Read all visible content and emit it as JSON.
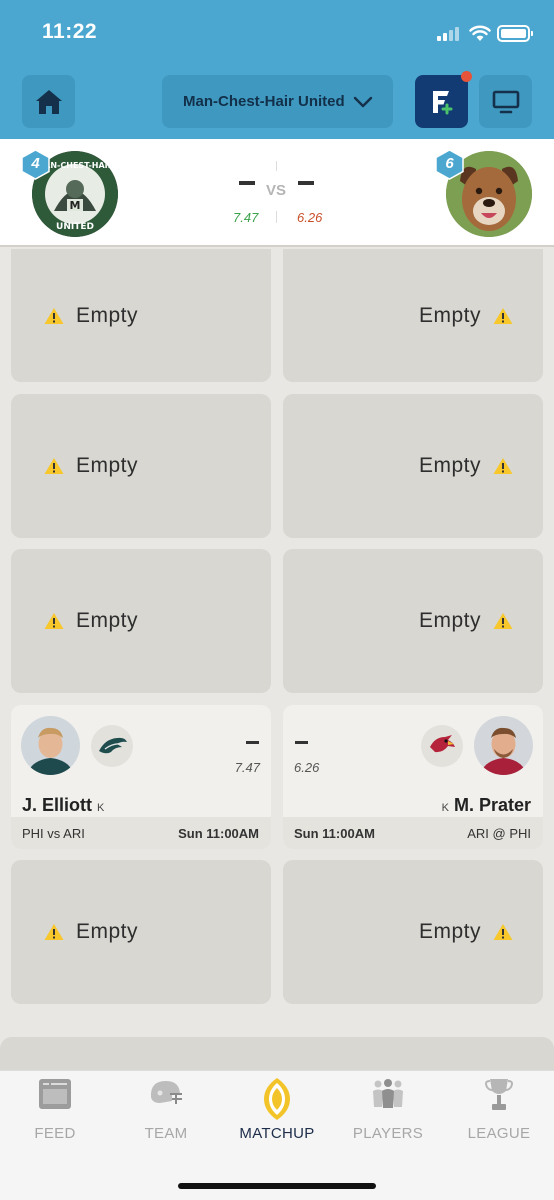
{
  "status_bar": {
    "time": "11:22"
  },
  "header": {
    "team_name": "Man-Chest-Hair United",
    "home_icon": "home-icon",
    "dropdown_icon": "chevron-down-icon",
    "fanduel_icon": "fantasy-logo-icon",
    "tv_icon": "tv-icon"
  },
  "scoreboard": {
    "left_rank": "4",
    "right_rank": "6",
    "left_score": "–",
    "right_score": "–",
    "vs": "VS",
    "left_projection": "7.47",
    "right_projection": "6.26",
    "left_avatar_text_top": "MAN-CHEST-HAIR",
    "left_avatar_text_bottom": "UNITED",
    "left_avatar_letter": "M"
  },
  "slots": {
    "empty_label": "Empty",
    "warning_icon": "warning-icon"
  },
  "matchup_row": {
    "left": {
      "name": "J. Elliott",
      "position": "K",
      "score": "–",
      "projection": "7.47",
      "team_icon": "eagles-logo-icon",
      "game": "PHI vs ARI",
      "time": "Sun 11:00AM"
    },
    "right": {
      "name": "M. Prater",
      "position": "K",
      "score": "–",
      "projection": "6.26",
      "team_icon": "cardinals-logo-icon",
      "game": "ARI @ PHI",
      "time": "Sun 11:00AM"
    }
  },
  "tabs": [
    {
      "label": "FEED",
      "icon": "feed-icon"
    },
    {
      "label": "TEAM",
      "icon": "helmet-icon"
    },
    {
      "label": "MATCHUP",
      "icon": "football-icon"
    },
    {
      "label": "PLAYERS",
      "icon": "players-icon"
    },
    {
      "label": "LEAGUE",
      "icon": "trophy-icon"
    }
  ],
  "colors": {
    "header_bg": "#4ba7cf",
    "accent_navy": "#123b74",
    "positive": "#3aa24b",
    "negative": "#c9502a"
  }
}
